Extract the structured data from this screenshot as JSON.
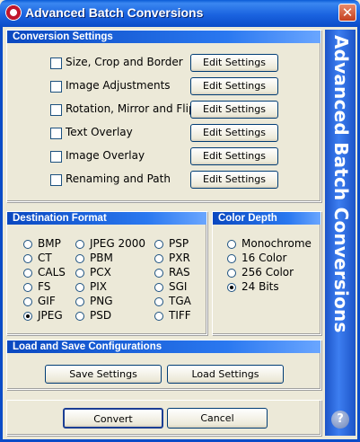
{
  "window": {
    "title": "Advanced Batch Conversions",
    "side_banner": "Advanced Batch Conversions",
    "help_label": "?"
  },
  "icons": {
    "app": "app-logo-icon",
    "close": "close-icon",
    "help": "help-icon"
  },
  "conversion": {
    "heading": "Conversion Settings",
    "items": [
      {
        "label": "Size, Crop and Border",
        "checked": false,
        "button": "Edit Settings"
      },
      {
        "label": "Image Adjustments",
        "checked": false,
        "button": "Edit Settings"
      },
      {
        "label": "Rotation, Mirror and Flip",
        "checked": false,
        "button": "Edit Settings"
      },
      {
        "label": "Text Overlay",
        "checked": false,
        "button": "Edit Settings"
      },
      {
        "label": "Image Overlay",
        "checked": false,
        "button": "Edit Settings"
      },
      {
        "label": "Renaming and Path",
        "checked": false,
        "button": "Edit Settings"
      }
    ]
  },
  "destination": {
    "heading": "Destination Format",
    "columns": [
      [
        "BMP",
        "CT",
        "CALS",
        "FS",
        "GIF",
        "JPEG"
      ],
      [
        "JPEG 2000",
        "PBM",
        "PCX",
        "PIX",
        "PNG",
        "PSD"
      ],
      [
        "PSP",
        "PXR",
        "RAS",
        "SGI",
        "TGA",
        "TIFF"
      ]
    ],
    "selected": "JPEG"
  },
  "color_depth": {
    "heading": "Color Depth",
    "options": [
      "Monochrome",
      "16 Color",
      "256 Color",
      "24 Bits"
    ],
    "selected": "24 Bits"
  },
  "configs": {
    "heading": "Load and Save Configurations",
    "save": "Save Settings",
    "load": "Load Settings"
  },
  "footer": {
    "convert": "Convert",
    "cancel": "Cancel"
  }
}
